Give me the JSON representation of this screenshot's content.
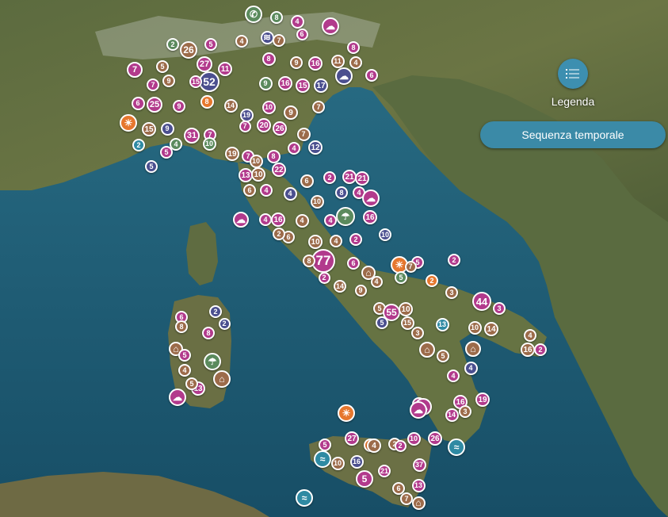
{
  "controls": {
    "legend_label": "Legenda",
    "timeline_label": "Sequenza temporale",
    "legend_icon": "list-icon"
  },
  "colors": {
    "magenta": "#b23a8c",
    "brown": "#9c6b4a",
    "indigo": "#4b4f8f",
    "orange": "#e6772e",
    "green": "#5b8a5d",
    "teal": "#2f8aa3"
  },
  "markers": [
    {
      "label": "",
      "icon": "phone-icon",
      "color": "green"
    },
    {
      "label": "8",
      "color": "green"
    },
    {
      "label": "4",
      "color": "magenta"
    },
    {
      "label": "",
      "icon": "cloud-icon",
      "color": "magenta"
    },
    {
      "label": "6",
      "color": "magenta"
    },
    {
      "label": "",
      "icon": "flood-icon",
      "color": "indigo"
    },
    {
      "label": "7",
      "color": "brown"
    },
    {
      "label": "5",
      "color": "magenta"
    },
    {
      "label": "4",
      "color": "brown"
    },
    {
      "label": "2",
      "color": "green"
    },
    {
      "label": "26",
      "color": "brown"
    },
    {
      "label": "27",
      "color": "magenta"
    },
    {
      "label": "8",
      "color": "magenta"
    },
    {
      "label": "9",
      "color": "brown"
    },
    {
      "label": "16",
      "color": "magenta"
    },
    {
      "label": "11",
      "color": "brown"
    },
    {
      "label": "8",
      "color": "magenta"
    },
    {
      "label": "4",
      "color": "brown"
    },
    {
      "label": "5",
      "color": "brown"
    },
    {
      "label": "7",
      "color": "magenta"
    },
    {
      "label": "52",
      "color": "indigo"
    },
    {
      "label": "15",
      "color": "magenta"
    },
    {
      "label": "9",
      "color": "brown"
    },
    {
      "label": "9",
      "color": "green"
    },
    {
      "label": "16",
      "color": "magenta"
    },
    {
      "label": "15",
      "color": "magenta"
    },
    {
      "label": "17",
      "color": "indigo"
    },
    {
      "label": "",
      "icon": "cloud-icon",
      "color": "indigo"
    },
    {
      "label": "6",
      "color": "magenta"
    },
    {
      "label": "11",
      "color": "magenta"
    },
    {
      "label": "8",
      "color": "orange"
    },
    {
      "label": "25",
      "color": "magenta"
    },
    {
      "label": "6",
      "color": "magenta"
    },
    {
      "label": "7",
      "color": "magenta"
    },
    {
      "label": "9",
      "color": "magenta"
    },
    {
      "label": "14",
      "color": "brown"
    },
    {
      "label": "10",
      "color": "magenta"
    },
    {
      "label": "9",
      "color": "brown"
    },
    {
      "label": "7",
      "color": "brown"
    },
    {
      "label": "",
      "icon": "sun-icon",
      "color": "orange"
    },
    {
      "label": "15",
      "color": "brown"
    },
    {
      "label": "9",
      "color": "indigo"
    },
    {
      "label": "19",
      "color": "indigo"
    },
    {
      "label": "20",
      "color": "magenta"
    },
    {
      "label": "26",
      "color": "magenta"
    },
    {
      "label": "7",
      "color": "magenta"
    },
    {
      "label": "31",
      "color": "magenta"
    },
    {
      "label": "7",
      "color": "magenta"
    },
    {
      "label": "10",
      "color": "green"
    },
    {
      "label": "7",
      "color": "brown"
    },
    {
      "label": "2",
      "color": "teal"
    },
    {
      "label": "4",
      "color": "green"
    },
    {
      "label": "5",
      "color": "magenta"
    },
    {
      "label": "4",
      "color": "magenta"
    },
    {
      "label": "12",
      "color": "indigo"
    },
    {
      "label": "8",
      "color": "magenta"
    },
    {
      "label": "19",
      "color": "brown"
    },
    {
      "label": "7",
      "color": "magenta"
    },
    {
      "label": "10",
      "color": "brown"
    },
    {
      "label": "5",
      "color": "indigo"
    },
    {
      "label": "13",
      "color": "magenta"
    },
    {
      "label": "22",
      "color": "magenta"
    },
    {
      "label": "10",
      "color": "brown"
    },
    {
      "label": "21",
      "color": "magenta"
    },
    {
      "label": "21",
      "color": "magenta"
    },
    {
      "label": "2",
      "color": "magenta"
    },
    {
      "label": "6",
      "color": "brown"
    },
    {
      "label": "6",
      "color": "brown"
    },
    {
      "label": "4",
      "color": "magenta"
    },
    {
      "label": "4",
      "color": "indigo"
    },
    {
      "label": "8",
      "color": "indigo"
    },
    {
      "label": "4",
      "color": "magenta"
    },
    {
      "label": "",
      "icon": "cloud-icon",
      "color": "magenta"
    },
    {
      "label": "10",
      "color": "brown"
    },
    {
      "label": "",
      "icon": "rain-icon",
      "color": "green"
    },
    {
      "label": "16",
      "color": "magenta"
    },
    {
      "label": "",
      "icon": "cloud-icon",
      "color": "magenta"
    },
    {
      "label": "4",
      "color": "magenta"
    },
    {
      "label": "16",
      "color": "magenta"
    },
    {
      "label": "4",
      "color": "brown"
    },
    {
      "label": "4",
      "color": "magenta"
    },
    {
      "label": "6",
      "color": "brown"
    },
    {
      "label": "2",
      "color": "brown"
    },
    {
      "label": "10",
      "color": "indigo"
    },
    {
      "label": "10",
      "color": "brown"
    },
    {
      "label": "4",
      "color": "brown"
    },
    {
      "label": "2",
      "color": "magenta"
    },
    {
      "label": "77",
      "color": "magenta"
    },
    {
      "label": "8",
      "color": "brown"
    },
    {
      "label": "6",
      "color": "magenta"
    },
    {
      "label": "",
      "icon": "landslide-icon",
      "color": "brown"
    },
    {
      "label": "",
      "icon": "sun-icon",
      "color": "orange"
    },
    {
      "label": "5",
      "color": "magenta"
    },
    {
      "label": "7",
      "color": "brown"
    },
    {
      "label": "2",
      "color": "magenta"
    },
    {
      "label": "2",
      "color": "magenta"
    },
    {
      "label": "14",
      "color": "brown"
    },
    {
      "label": "9",
      "color": "brown"
    },
    {
      "label": "4",
      "color": "brown"
    },
    {
      "label": "5",
      "color": "green"
    },
    {
      "label": "2",
      "color": "orange"
    },
    {
      "label": "3",
      "color": "brown"
    },
    {
      "label": "44",
      "color": "magenta"
    },
    {
      "label": "3",
      "color": "magenta"
    },
    {
      "label": "5",
      "color": "brown"
    },
    {
      "label": "55",
      "color": "magenta"
    },
    {
      "label": "10",
      "color": "brown"
    },
    {
      "label": "5",
      "color": "indigo"
    },
    {
      "label": "15",
      "color": "brown"
    },
    {
      "label": "13",
      "color": "teal"
    },
    {
      "label": "10",
      "color": "brown"
    },
    {
      "label": "14",
      "color": "brown"
    },
    {
      "label": "3",
      "color": "brown"
    },
    {
      "label": "",
      "icon": "landslide-icon",
      "color": "brown"
    },
    {
      "label": "",
      "icon": "landslide-icon",
      "color": "brown"
    },
    {
      "label": "5",
      "color": "brown"
    },
    {
      "label": "4",
      "color": "brown"
    },
    {
      "label": "16",
      "color": "brown"
    },
    {
      "label": "2",
      "color": "magenta"
    },
    {
      "label": "4",
      "color": "indigo"
    },
    {
      "label": "4",
      "color": "magenta"
    },
    {
      "label": "16",
      "color": "magenta"
    },
    {
      "label": "19",
      "color": "magenta"
    },
    {
      "label": "14",
      "color": "magenta"
    },
    {
      "label": "3",
      "color": "brown"
    },
    {
      "label": "2",
      "color": "magenta"
    },
    {
      "label": "",
      "icon": "cloud-icon",
      "color": "magenta"
    },
    {
      "label": "6",
      "color": "magenta"
    },
    {
      "label": "8",
      "color": "brown"
    },
    {
      "label": "2",
      "color": "indigo"
    },
    {
      "label": "8",
      "color": "magenta"
    },
    {
      "label": "2",
      "color": "indigo"
    },
    {
      "label": "",
      "icon": "landslide-icon",
      "color": "brown"
    },
    {
      "label": "5",
      "color": "magenta"
    },
    {
      "label": "",
      "icon": "rain-icon",
      "color": "green"
    },
    {
      "label": "4",
      "color": "brown"
    },
    {
      "label": "",
      "icon": "landslide-icon",
      "color": "brown"
    },
    {
      "label": "13",
      "color": "magenta"
    },
    {
      "label": "5",
      "color": "brown"
    },
    {
      "label": "",
      "icon": "cloud-icon",
      "color": "magenta"
    },
    {
      "label": "",
      "icon": "sun-icon",
      "color": "orange"
    },
    {
      "label": "27",
      "color": "magenta"
    },
    {
      "label": "5",
      "color": "orange"
    },
    {
      "label": "2",
      "color": "brown"
    },
    {
      "label": "10",
      "color": "magenta"
    },
    {
      "label": "26",
      "color": "magenta"
    },
    {
      "label": "5",
      "color": "magenta"
    },
    {
      "label": "",
      "icon": "wave-icon",
      "color": "teal"
    },
    {
      "label": "10",
      "color": "brown"
    },
    {
      "label": "16",
      "color": "indigo"
    },
    {
      "label": "4",
      "color": "brown"
    },
    {
      "label": "21",
      "color": "magenta"
    },
    {
      "label": "5",
      "color": "magenta"
    },
    {
      "label": "37",
      "color": "magenta"
    },
    {
      "label": "13",
      "color": "magenta"
    },
    {
      "label": "6",
      "color": "brown"
    },
    {
      "label": "7",
      "color": "brown"
    },
    {
      "label": "",
      "icon": "landslide-icon",
      "color": "brown"
    },
    {
      "label": "",
      "icon": "wave-icon",
      "color": "teal"
    },
    {
      "label": "",
      "icon": "wave-icon",
      "color": "teal"
    },
    {
      "label": "2",
      "color": "magenta"
    },
    {
      "label": "",
      "icon": "cloud-icon",
      "color": "magenta"
    }
  ]
}
